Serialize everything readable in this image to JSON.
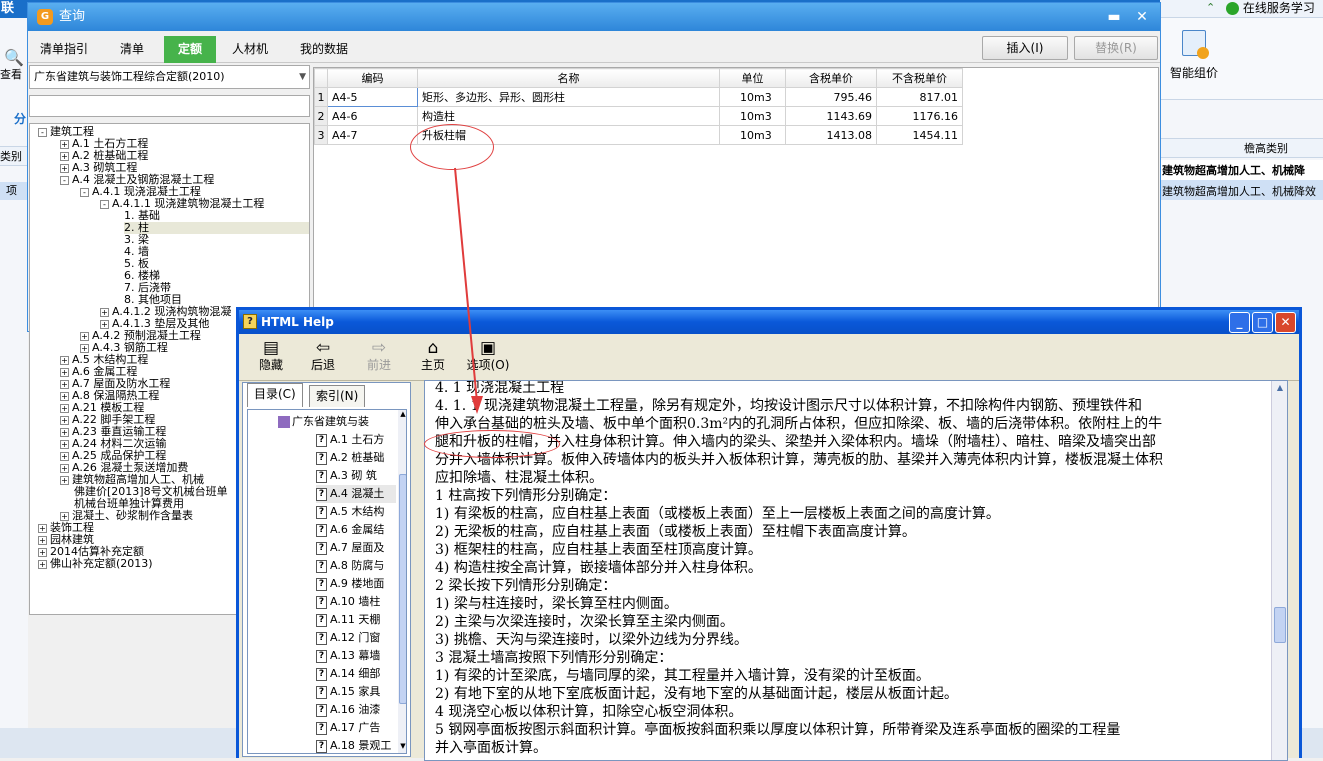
{
  "background": {
    "top_left_text": "联",
    "online_service": "在线服务学习",
    "smart_price_label": "智能组价",
    "left_labels": [
      "查看",
      "分",
      "类别",
      "项"
    ],
    "right_header": "檐高类别",
    "right_rows": [
      "建筑物超高增加人工、机械降",
      "建筑物超高增加人工、机械降效"
    ]
  },
  "query": {
    "title": "查询",
    "tabs": [
      "清单指引",
      "清单",
      "定额",
      "人材机",
      "我的数据"
    ],
    "active_tab": "定额",
    "insert_button": "插入(I)",
    "replace_button": "替换(R)",
    "library": "广东省建筑与装饰工程综合定额(2010)",
    "tree": [
      {
        "label": "建筑工程",
        "sign": "-"
      },
      {
        "label": "A.1 土石方工程",
        "sign": "+"
      },
      {
        "label": "A.2 桩基础工程",
        "sign": "+"
      },
      {
        "label": "A.3 砌筑工程",
        "sign": "+"
      },
      {
        "label": "A.4 混凝土及钢筋混凝土工程",
        "sign": "-"
      },
      {
        "label": "A.4.1 现浇混凝土工程",
        "sign": "-"
      },
      {
        "label": "A.4.1.1 现浇建筑物混凝土工程",
        "sign": "-"
      },
      {
        "label": "1. 基础",
        "sign": ""
      },
      {
        "label": "2. 柱",
        "sign": ""
      },
      {
        "label": "3. 梁",
        "sign": ""
      },
      {
        "label": "4. 墙",
        "sign": ""
      },
      {
        "label": "5. 板",
        "sign": ""
      },
      {
        "label": "6. 楼梯",
        "sign": ""
      },
      {
        "label": "7. 后浇带",
        "sign": ""
      },
      {
        "label": "8. 其他项目",
        "sign": ""
      },
      {
        "label": "A.4.1.2 现浇构筑物混凝",
        "sign": "+"
      },
      {
        "label": "A.4.1.3 垫层及其他",
        "sign": "+"
      },
      {
        "label": "A.4.2 预制混凝土工程",
        "sign": "+"
      },
      {
        "label": "A.4.3 钢筋工程",
        "sign": "+"
      },
      {
        "label": "A.5 木结构工程",
        "sign": "+"
      },
      {
        "label": "A.6 金属工程",
        "sign": "+"
      },
      {
        "label": "A.7 屋面及防水工程",
        "sign": "+"
      },
      {
        "label": "A.8 保温隔热工程",
        "sign": "+"
      },
      {
        "label": "A.21 模板工程",
        "sign": "+"
      },
      {
        "label": "A.22 脚手架工程",
        "sign": "+"
      },
      {
        "label": "A.23 垂直运输工程",
        "sign": "+"
      },
      {
        "label": "A.24 材料二次运输",
        "sign": "+"
      },
      {
        "label": "A.25 成品保护工程",
        "sign": "+"
      },
      {
        "label": "A.26 混凝土泵送增加费",
        "sign": "+"
      },
      {
        "label": "建筑物超高增加人工、机械",
        "sign": "+"
      },
      {
        "label": "佛建价[2013]8号文机械台班单",
        "sign": ""
      },
      {
        "label": "机械台班单独计算费用",
        "sign": ""
      },
      {
        "label": "混凝土、砂浆制作含量表",
        "sign": "+"
      },
      {
        "label": "装饰工程",
        "sign": "+"
      },
      {
        "label": "园林建筑",
        "sign": "+"
      },
      {
        "label": "2014估算补充定额",
        "sign": "+"
      },
      {
        "label": "佛山补充定额(2013)",
        "sign": "+"
      }
    ],
    "grid": {
      "headers": [
        "编码",
        "名称",
        "单位",
        "含税单价",
        "不含税单价"
      ],
      "rows": [
        {
          "n": "1",
          "code": "A4-5",
          "name": "矩形、多边形、异形、圆形柱",
          "unit": "10m3",
          "price_tax": "795.46",
          "price_notax": "817.01"
        },
        {
          "n": "2",
          "code": "A4-6",
          "name": "构造柱",
          "unit": "10m3",
          "price_tax": "1143.69",
          "price_notax": "1176.16"
        },
        {
          "n": "3",
          "code": "A4-7",
          "name": "升板柱帽",
          "unit": "10m3",
          "price_tax": "1413.08",
          "price_notax": "1454.11"
        }
      ]
    }
  },
  "help": {
    "title": "HTML Help",
    "toolbar": [
      "隐藏",
      "后退",
      "前进",
      "主页",
      "选项(O)"
    ],
    "nav_tabs": [
      "目录(C)",
      "索引(N)"
    ],
    "toc_root": "广东省建筑与装",
    "toc": [
      "A.1 土石方",
      "A.2 桩基础",
      "A.3 砌 筑",
      "A.4 混凝土",
      "A.5 木结构",
      "A.6 金属结",
      "A.7 屋面及",
      "A.8 防腐与",
      "A.9 楼地面",
      "A.10 墙柱",
      "A.11 天棚",
      "A.12 门窗",
      "A.13 幕墙",
      "A.14 细部",
      "A.15 家具",
      "A.16 油漆",
      "A.17 广告",
      "A.18 景观工",
      "A.19 石作工",
      "A.20 其他"
    ],
    "content": [
      "4. 1 现浇混凝土工程",
      "4. 1. 1  现浇建筑物混凝土工程量，除另有规定外，均按设计图示尺寸以体积计算，不扣除构件内钢筋、预埋铁件和",
      "伸入承台基础的桩头及墙、板中单个面积0.3m²内的孔洞所占体积，但应扣除梁、板、墙的后浇带体积。依附柱上的牛",
      "腿和升板的柱帽，并入柱身体积计算。伸入墙内的梁头、梁垫并入梁体积内。墙垛（附墙柱）、暗柱、暗梁及墙突出部",
      "分并入墙体积计算。板伸入砖墙体内的板头并入板体积计算，薄壳板的肋、基梁并入薄壳体积内计算，楼板混凝土体积",
      "应扣除墙、柱混凝土体积。",
      "    1  柱高按下列情形分别确定：",
      "    1)    有梁板的柱高，应自柱基上表面（或楼板上表面）至上一层楼板上表面之间的高度计算。",
      "    2)    无梁板的柱高，应自柱基上表面（或楼板上表面）至柱帽下表面高度计算。",
      "    3)    框架柱的柱高，应自柱基上表面至柱顶高度计算。",
      "    4)    构造柱按全高计算，嵌接墙体部分并入柱身体积。",
      "    2  梁长按下列情形分别确定：",
      "    1)    梁与柱连接时，梁长算至柱内侧面。",
      "    2)    主梁与次梁连接时，次梁长算至主梁内侧面。",
      "    3)    挑檐、天沟与梁连接时，以梁外边线为分界线。",
      "    3  混凝土墙高按照下列情形分别确定：",
      "    1)    有梁的计至梁底，与墙同厚的梁，其工程量并入墙计算，没有梁的计至板面。",
      "    2)    有地下室的从地下室底板面计起，没有地下室的从基础面计起，楼层从板面计起。",
      "    4  现浇空心板以体积计算，扣除空心板空洞体积。",
      "    5  钢网亭面板按图示斜面积计算。亭面板按斜面积乘以厚度以体积计算，所带脊梁及连系亭面板的圈梁的工程量",
      "并入亭面板计算。"
    ]
  }
}
